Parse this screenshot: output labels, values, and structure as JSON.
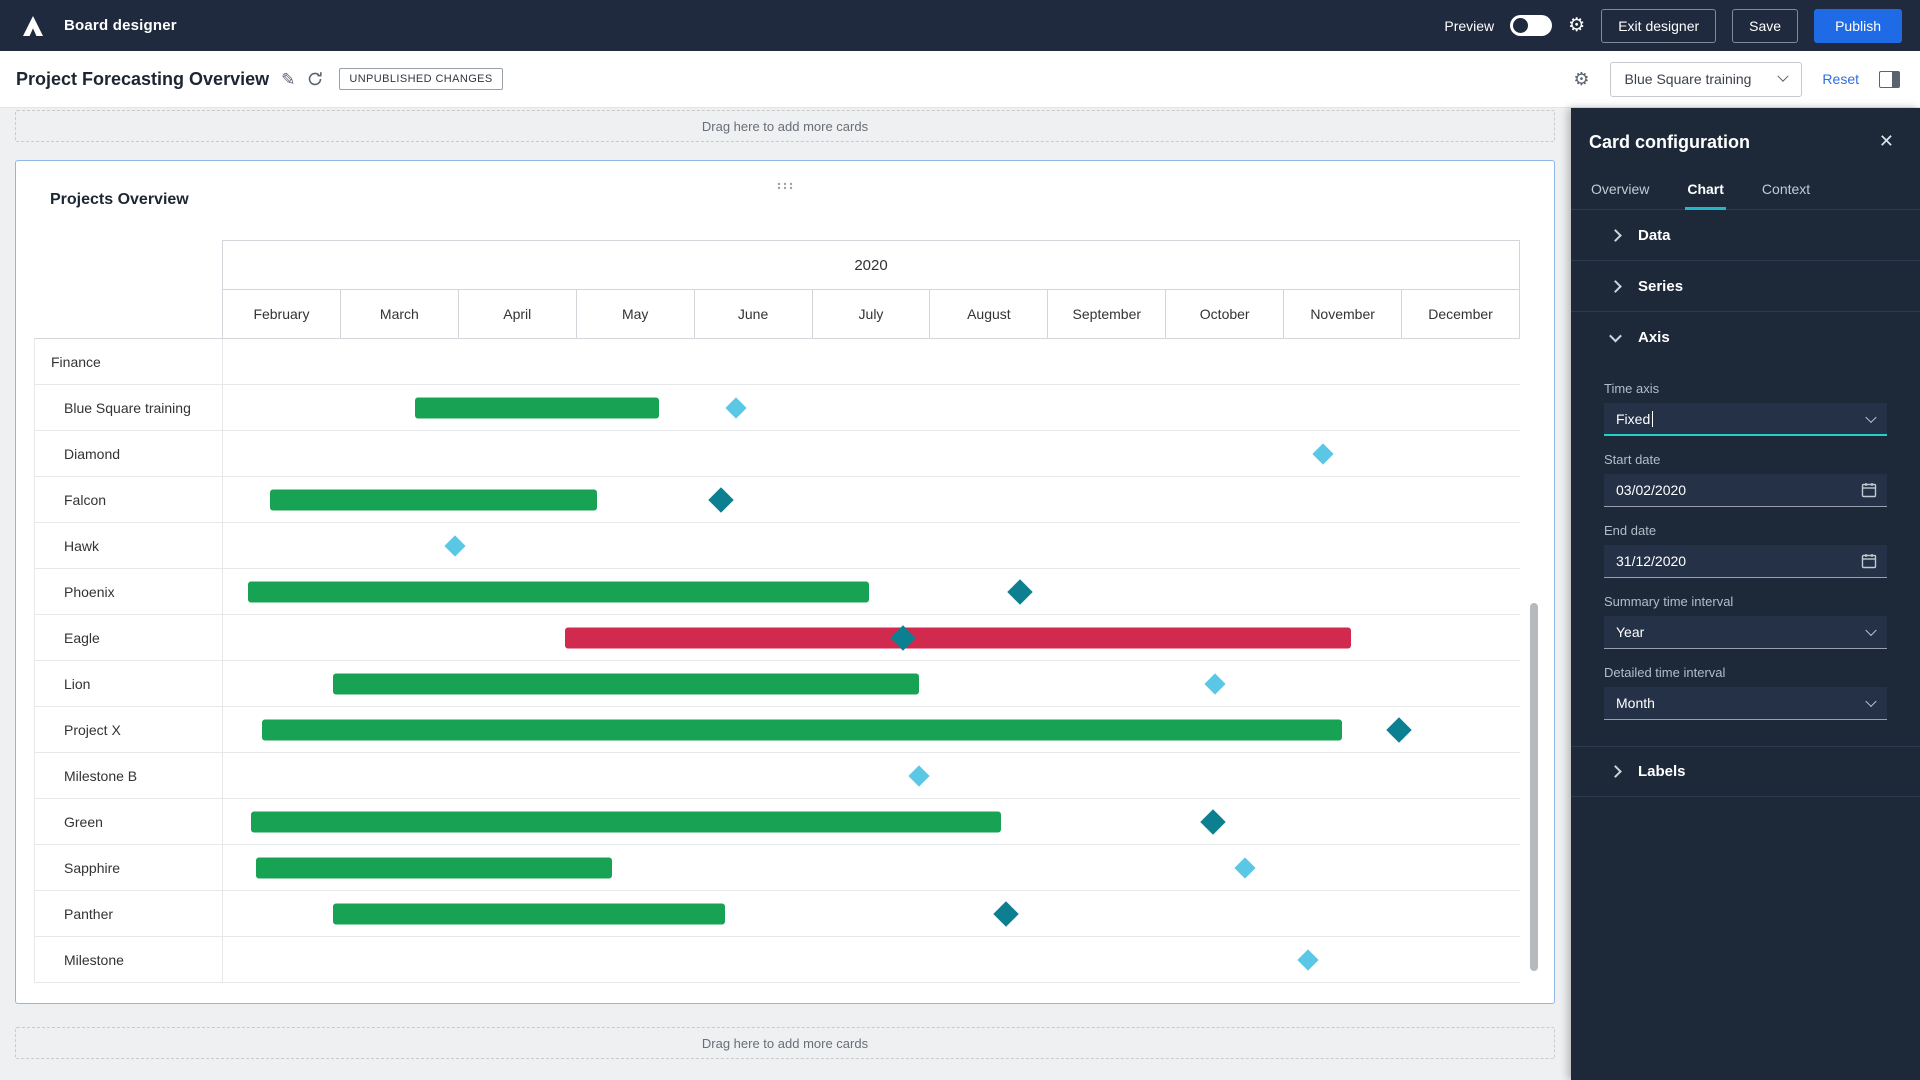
{
  "colors": {
    "topbar_bg": "#1f2a3e",
    "sidebar_bg": "#1d2838",
    "publish_blue": "#1f6be6",
    "link_blue": "#2e6fe0",
    "tab_underline": "#1fb9c9",
    "focus_teal": "#23d0c7",
    "card_selection_border": "#8fb8e6"
  },
  "topbar": {
    "app_title": "Board designer",
    "preview_label": "Preview",
    "exit_button": "Exit designer",
    "save_button": "Save",
    "publish_button": "Publish"
  },
  "header": {
    "title": "Project Forecasting Overview",
    "badge": "UNPUBLISHED CHANGES",
    "context_selector": "Blue Square training",
    "reset_label": "Reset"
  },
  "dropzones": {
    "top": "Drag here to add more cards",
    "bottom": "Drag here to add more cards"
  },
  "card": {
    "title": "Projects Overview"
  },
  "chart_data": {
    "type": "gantt",
    "title": "Projects Overview",
    "year_label": "2020",
    "months": [
      "February",
      "March",
      "April",
      "May",
      "June",
      "July",
      "August",
      "September",
      "October",
      "November",
      "December"
    ],
    "timeline_span_months": 11,
    "colors": {
      "bar_green": "#17a353",
      "bar_red": "#d12a4e",
      "milestone_light": "#5ac8e5",
      "milestone_dark": "#0c7f90"
    },
    "rows": [
      {
        "label": "Finance",
        "indent": 0
      },
      {
        "label": "Blue Square training",
        "indent": 1,
        "bar": {
          "start": 1.63,
          "end": 3.7,
          "color": "green"
        },
        "milestone": {
          "at": 4.35,
          "color": "light"
        }
      },
      {
        "label": "Diamond",
        "indent": 1,
        "milestone": {
          "at": 9.33,
          "color": "light"
        }
      },
      {
        "label": "Falcon",
        "indent": 1,
        "bar": {
          "start": 0.4,
          "end": 3.17,
          "color": "green"
        },
        "milestone": {
          "at": 4.22,
          "color": "dark"
        }
      },
      {
        "label": "Hawk",
        "indent": 1,
        "milestone": {
          "at": 1.97,
          "color": "light"
        }
      },
      {
        "label": "Phoenix",
        "indent": 1,
        "bar": {
          "start": 0.21,
          "end": 5.48,
          "color": "green"
        },
        "milestone": {
          "at": 6.76,
          "color": "dark"
        }
      },
      {
        "label": "Eagle",
        "indent": 1,
        "bar": {
          "start": 2.9,
          "end": 9.57,
          "color": "red"
        },
        "milestone": {
          "at": 5.77,
          "color": "dark"
        }
      },
      {
        "label": "Lion",
        "indent": 1,
        "bar": {
          "start": 0.93,
          "end": 5.9,
          "color": "green"
        },
        "milestone": {
          "at": 8.41,
          "color": "light"
        }
      },
      {
        "label": "Project X",
        "indent": 1,
        "bar": {
          "start": 0.33,
          "end": 9.49,
          "color": "green"
        },
        "milestone": {
          "at": 9.97,
          "color": "dark"
        }
      },
      {
        "label": "Milestone B",
        "indent": 1,
        "milestone": {
          "at": 5.9,
          "color": "light"
        }
      },
      {
        "label": "Green",
        "indent": 1,
        "bar": {
          "start": 0.24,
          "end": 6.6,
          "color": "green"
        },
        "milestone": {
          "at": 8.4,
          "color": "dark"
        }
      },
      {
        "label": "Sapphire",
        "indent": 1,
        "bar": {
          "start": 0.28,
          "end": 3.3,
          "color": "green"
        },
        "milestone": {
          "at": 8.67,
          "color": "light"
        }
      },
      {
        "label": "Panther",
        "indent": 1,
        "bar": {
          "start": 0.93,
          "end": 4.26,
          "color": "green"
        },
        "milestone": {
          "at": 6.64,
          "color": "dark"
        }
      },
      {
        "label": "Milestone",
        "indent": 1,
        "milestone": {
          "at": 9.2,
          "color": "light"
        }
      }
    ]
  },
  "sidebar": {
    "title": "Card configuration",
    "tabs": [
      {
        "label": "Overview"
      },
      {
        "label": "Chart"
      },
      {
        "label": "Context"
      }
    ],
    "sections": {
      "data": "Data",
      "series": "Series",
      "axis": "Axis",
      "labels": "Labels"
    },
    "axis": {
      "fields": [
        {
          "label": "Time axis",
          "value": "Fixed"
        },
        {
          "label": "Start date",
          "value": "03/02/2020"
        },
        {
          "label": "End date",
          "value": "31/12/2020"
        },
        {
          "label": "Summary time interval",
          "value": "Year"
        },
        {
          "label": "Detailed time interval",
          "value": "Month"
        }
      ]
    }
  }
}
